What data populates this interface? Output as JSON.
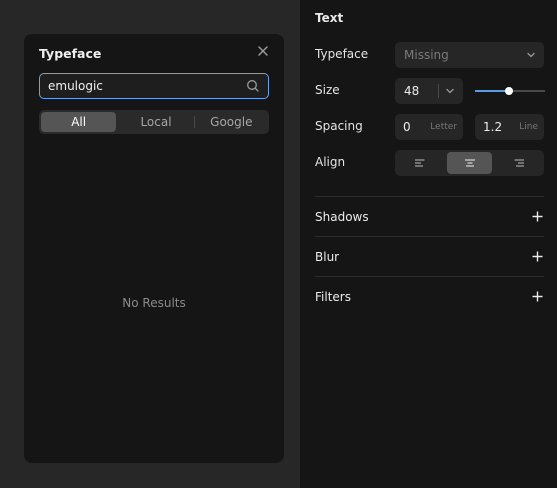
{
  "font_panel": {
    "title": "Typeface",
    "search_value": "emulogic",
    "tabs": [
      {
        "label": "All",
        "active": true
      },
      {
        "label": "Local",
        "active": false
      },
      {
        "label": "Google",
        "active": false
      }
    ],
    "empty_text": "No Results"
  },
  "inspector": {
    "section_title": "Text",
    "typeface": {
      "label": "Typeface",
      "value": "Missing"
    },
    "size": {
      "label": "Size",
      "value": "48",
      "slider_fraction": 0.48
    },
    "spacing": {
      "label": "Spacing",
      "letter": {
        "value": "0",
        "unit": "Letter"
      },
      "line": {
        "value": "1.2",
        "unit": "Line"
      }
    },
    "align": {
      "label": "Align",
      "options": [
        "left",
        "center",
        "right"
      ],
      "selected": "center"
    },
    "sections": [
      {
        "label": "Shadows",
        "icon": "plus-icon"
      },
      {
        "label": "Blur",
        "icon": "plus-icon"
      },
      {
        "label": "Filters",
        "icon": "plus-icon"
      }
    ]
  },
  "colors": {
    "accent": "#5b9be9",
    "panel_bg": "#151515",
    "canvas_bg": "#272727",
    "control_bg": "#262626"
  }
}
